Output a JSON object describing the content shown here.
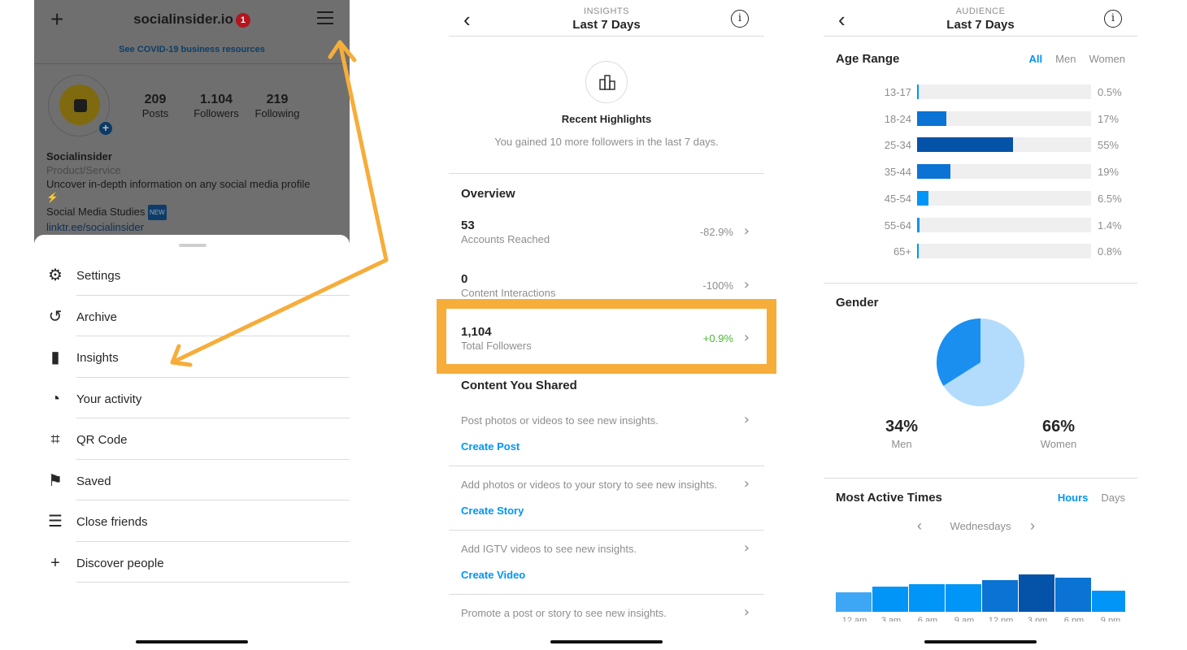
{
  "colors": {
    "accent_orange": "#f6ad3a",
    "link_blue": "#0095f6",
    "positive_green": "#4fb33a",
    "bar_light": "#3ea7f5",
    "bar_mid": "#0a73d4",
    "bar_dark": "#0553a8",
    "pie_men": "#1a8ff0",
    "pie_women": "#b3dbfc"
  },
  "profile": {
    "username": "socialinsider.io",
    "notification_count": "1",
    "covid_banner": "See COVID-19 business resources",
    "stats": [
      {
        "value": "209",
        "label": "Posts"
      },
      {
        "value": "1.104",
        "label": "Followers"
      },
      {
        "value": "219",
        "label": "Following"
      }
    ],
    "bio_name": "Socialinsider",
    "bio_category": "Product/Service",
    "bio_text": "Uncover in-depth information on any social media profile",
    "bio_line2": "Social Media Studies",
    "bio_badge": "NEW",
    "bio_link": "linktr.ee/socialinsider"
  },
  "menu": {
    "items": [
      {
        "label": "Settings",
        "icon": "settings-gear-icon",
        "glyph": "⚙"
      },
      {
        "label": "Archive",
        "icon": "archive-history-icon",
        "glyph": "↺"
      },
      {
        "label": "Insights",
        "icon": "insights-bar-chart-icon",
        "glyph": "▮"
      },
      {
        "label": "Your activity",
        "icon": "activity-clock-icon",
        "glyph": "◔"
      },
      {
        "label": "QR Code",
        "icon": "qr-code-icon",
        "glyph": "⌗"
      },
      {
        "label": "Saved",
        "icon": "saved-bookmark-icon",
        "glyph": "⚑"
      },
      {
        "label": "Close friends",
        "icon": "close-friends-list-icon",
        "glyph": "☰"
      },
      {
        "label": "Discover people",
        "icon": "discover-people-icon",
        "glyph": "+"
      }
    ]
  },
  "insights": {
    "header_super": "INSIGHTS",
    "header_title": "Last 7 Days",
    "highlights_title": "Recent Highlights",
    "highlights_desc": "You gained 10 more followers in the last 7 days.",
    "overview_title": "Overview",
    "metrics": [
      {
        "value": "53",
        "label": "Accounts Reached",
        "change": "-82.9%"
      },
      {
        "value": "0",
        "label": "Content Interactions",
        "change": "-100%"
      },
      {
        "value": "1,104",
        "label": "Total Followers",
        "change": "+0.9%"
      }
    ],
    "shared_title": "Content You Shared",
    "shared_rows": [
      {
        "desc": "Post photos or videos to see new insights.",
        "action": "Create Post"
      },
      {
        "desc": "Add photos or videos to your story to see new insights.",
        "action": "Create Story"
      },
      {
        "desc": "Add IGTV videos to see new insights.",
        "action": "Create Video"
      },
      {
        "desc": "Promote a post or story to see new insights.",
        "action": ""
      }
    ]
  },
  "audience": {
    "header_super": "AUDIENCE",
    "header_title": "Last 7 Days",
    "age_title": "Age Range",
    "age_tabs": [
      "All",
      "Men",
      "Women"
    ],
    "age_active_tab": "All",
    "gender_title": "Gender",
    "active_title": "Most Active Times",
    "active_tabs": [
      "Hours",
      "Days"
    ],
    "active_active_tab": "Hours",
    "day_label": "Wednesdays"
  },
  "chart_data": [
    {
      "type": "bar",
      "orientation": "horizontal",
      "title": "Age Range",
      "categories": [
        "13-17",
        "18-24",
        "25-34",
        "35-44",
        "45-54",
        "55-64",
        "65+"
      ],
      "values": [
        0.5,
        17,
        55,
        19,
        6.5,
        1.4,
        0.8
      ],
      "value_labels": [
        "0.5%",
        "17%",
        "55%",
        "19%",
        "6.5%",
        "1.4%",
        "0.8%"
      ],
      "xlim": [
        0,
        100
      ]
    },
    {
      "type": "pie",
      "title": "Gender",
      "categories": [
        "Men",
        "Women"
      ],
      "values": [
        34,
        66
      ],
      "value_labels": [
        "34%",
        "66%"
      ]
    },
    {
      "type": "bar",
      "title": "Most Active Times",
      "categories": [
        "12 am",
        "3 am",
        "6 am",
        "9 am",
        "12 pm",
        "3 pm",
        "6 pm",
        "9 pm"
      ],
      "values": [
        26,
        34,
        37,
        37,
        43,
        51,
        46,
        29
      ],
      "ylim": [
        0,
        60
      ]
    }
  ]
}
